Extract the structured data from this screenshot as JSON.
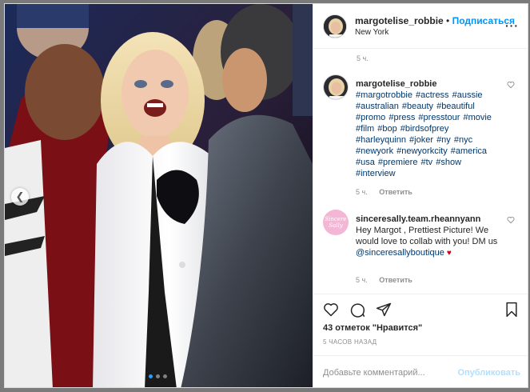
{
  "post": {
    "username": "margotelise_robbie",
    "separator": "•",
    "follow_label": "Подписаться",
    "location": "New York",
    "more_icon": "more-icon",
    "top_time": "5 ч."
  },
  "comments": [
    {
      "username": "margotelise_robbie",
      "text": "#margotrobbie #actress #aussie #australian #beauty #beautiful #promo #press #presstour #movie #film #bop #birdsofprey #harleyquinn #joker #ny #nyc #newyork #newyorkcity #america #usa #premiere #tv #show #interview",
      "time": "5 ч.",
      "reply_label": "Ответить"
    },
    {
      "username": "sinceresally.team.rheannyann",
      "text": "Hey Margot , Prettiest Picture! We would love to collab with you! DM us",
      "mention": "@sinceresallyboutique",
      "emoji": "♥",
      "time": "5 ч.",
      "reply_label": "Ответить",
      "avatar_text": "Sincere Sally"
    }
  ],
  "actions": {
    "likes_label": "43 отметок \"Нравится\"",
    "post_time": "5 ЧАСОВ НАЗАД",
    "comment_placeholder": "Добавьте комментарий...",
    "publish_label": "Опубликовать"
  },
  "carousel": {
    "slide_count": 3,
    "active_index": 0,
    "prev_glyph": "❮"
  },
  "colors": {
    "link": "#00376b",
    "follow": "#0095f6",
    "publish_disabled": "#b2dffc",
    "meta": "#8e8e8e"
  }
}
